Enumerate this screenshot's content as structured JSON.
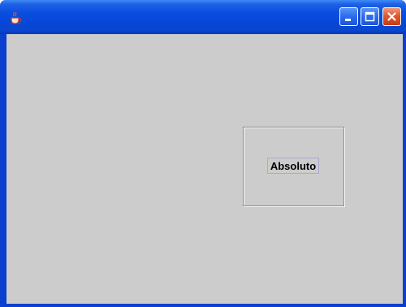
{
  "window": {
    "title": ""
  },
  "content": {
    "label": "Absoluto"
  },
  "icons": {
    "app": "java-cup-icon",
    "minimize": "minimize-icon",
    "maximize": "maximize-icon",
    "close": "close-icon"
  },
  "colors": {
    "titlebar": "#0a47d0",
    "client_bg": "#cccccc",
    "close_button": "#e0582e"
  }
}
